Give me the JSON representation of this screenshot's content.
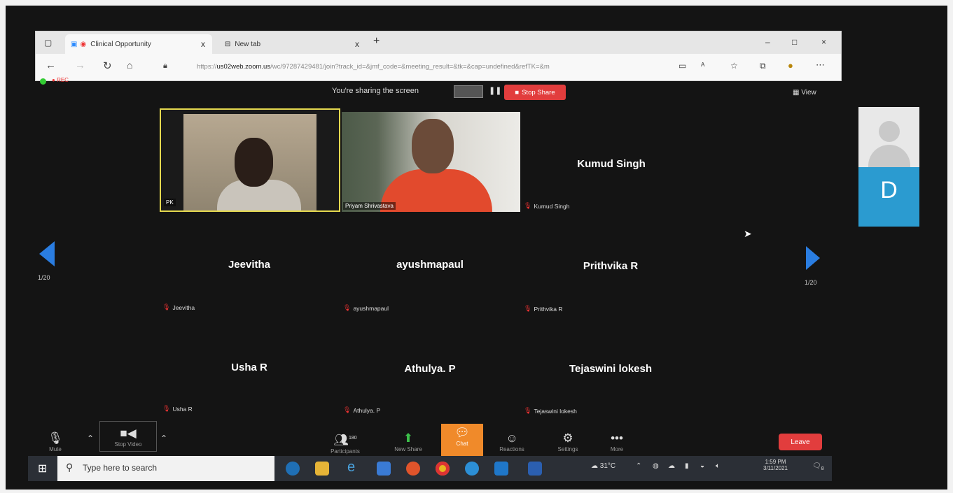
{
  "browser": {
    "tabs": [
      {
        "label": "Clinical Opportunity",
        "close": "x"
      },
      {
        "label": "New tab",
        "close": "x"
      }
    ],
    "new_tab": "+",
    "url_prefix": "https://",
    "url_host": "us02web.zoom.us",
    "url_rest": "/wc/97287429481/join?track_id=&jmf_code=&meeting_result=&tk=&cap=undefined&refTK=&m",
    "window_controls": [
      "–",
      "□",
      "×"
    ]
  },
  "zoom": {
    "rec_label": "REC",
    "share_status": "You're sharing the screen",
    "stop_share": "Stop Share",
    "view_label": "View",
    "page_left": "1/20",
    "page_right": "1/20",
    "self_initial": "D"
  },
  "participants": {
    "video1_label": "PK",
    "video2_label": "Priyam Shrivastava",
    "tiles": [
      {
        "name": "Kumud Singh",
        "label": "Kumud Singh"
      },
      {
        "name": "Jeevitha",
        "label": "Jeevitha"
      },
      {
        "name": "ayushmapaul",
        "label": "ayushmapaul"
      },
      {
        "name": "Prithvika R",
        "label": "Prithvika R"
      },
      {
        "name": "Usha R",
        "label": "Usha R"
      },
      {
        "name": "Athulya. P",
        "label": "Athulya. P"
      },
      {
        "name": "Tejaswini lokesh",
        "label": "Tejaswini lokesh"
      }
    ]
  },
  "toolbar": {
    "mute": "Mute",
    "stop_video": "Stop Video",
    "participants": "Participants",
    "participants_count": "180",
    "new_share": "New Share",
    "chat": "Chat",
    "reactions": "Reactions",
    "settings": "Settings",
    "more": "More",
    "leave": "Leave"
  },
  "taskbar": {
    "search_placeholder": "Type here to search",
    "weather": "31°C",
    "time": "1:59 PM",
    "date": "3/11/2021",
    "notification_count": "8"
  },
  "colors": {
    "zoom_blue": "#2a7de1",
    "stop_red": "#e23d3d",
    "chat_orange": "#f08a2a",
    "active_speaker": "#e5d94f"
  }
}
